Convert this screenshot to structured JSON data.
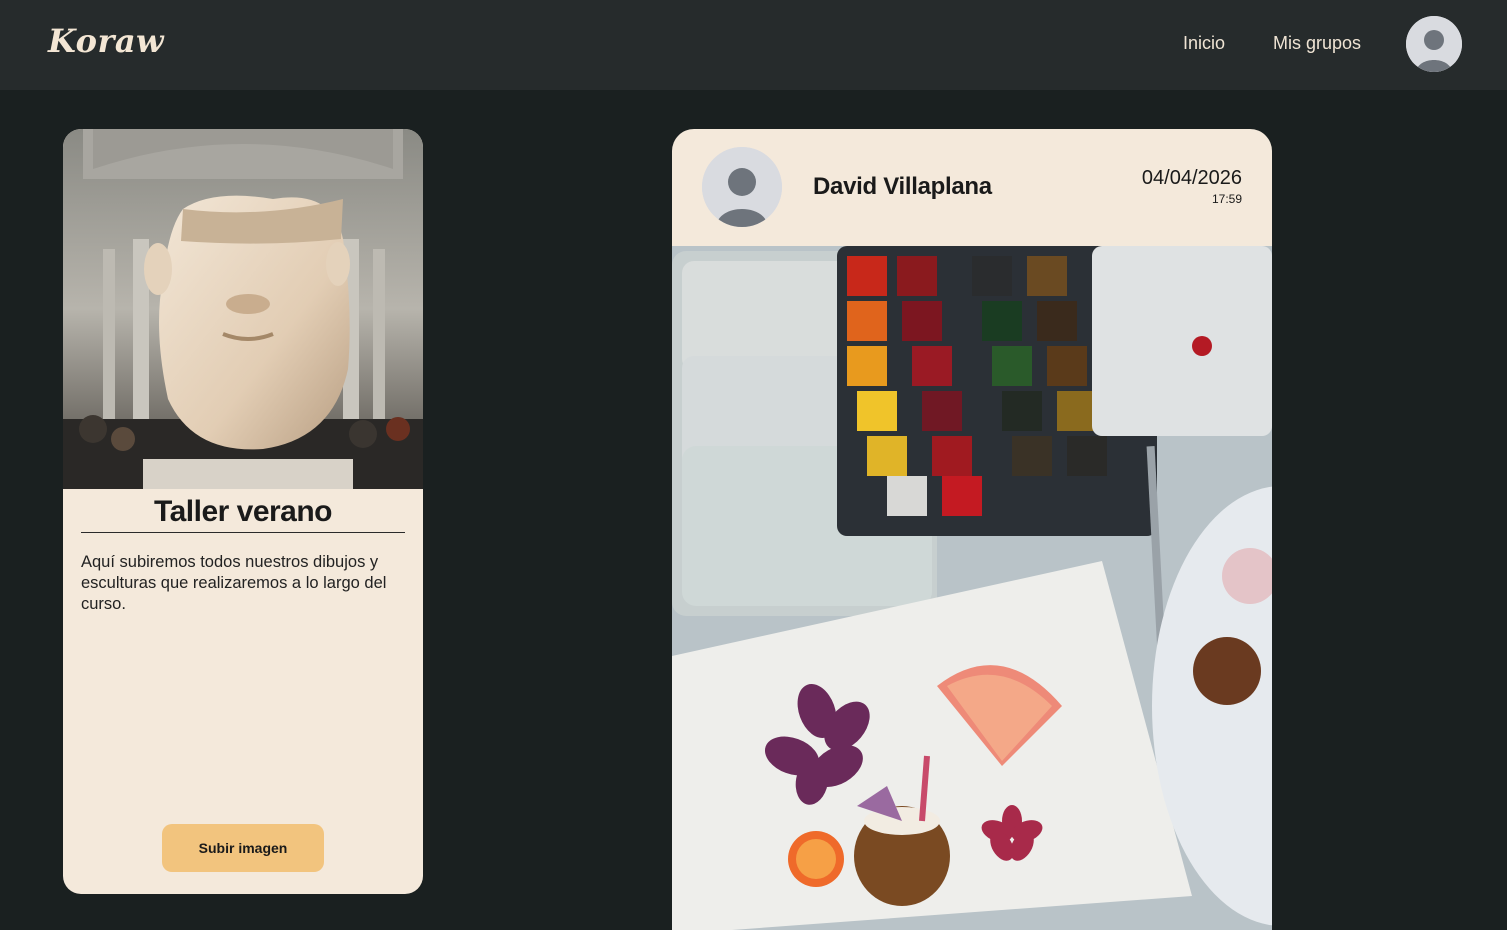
{
  "navbar": {
    "logo": "Koraw",
    "links": [
      {
        "label": "Inicio"
      },
      {
        "label": "Mis grupos"
      }
    ]
  },
  "group": {
    "title": "Taller verano",
    "description": "Aquí subiremos todos nuestros dibujos y esculturas que realizaremos a lo largo del curso.",
    "upload_label": "Subir imagen",
    "image_icon": "marble-sculpture-photo"
  },
  "post": {
    "author": "David Villaplana",
    "date": "04/04/2026",
    "time": "17:59",
    "image_icon": "watercolor-painting-photo"
  },
  "colors": {
    "background": "#1a2020",
    "navbar": "#262b2c",
    "card": "#f4e9db",
    "accent_button": "#f2c47e"
  }
}
